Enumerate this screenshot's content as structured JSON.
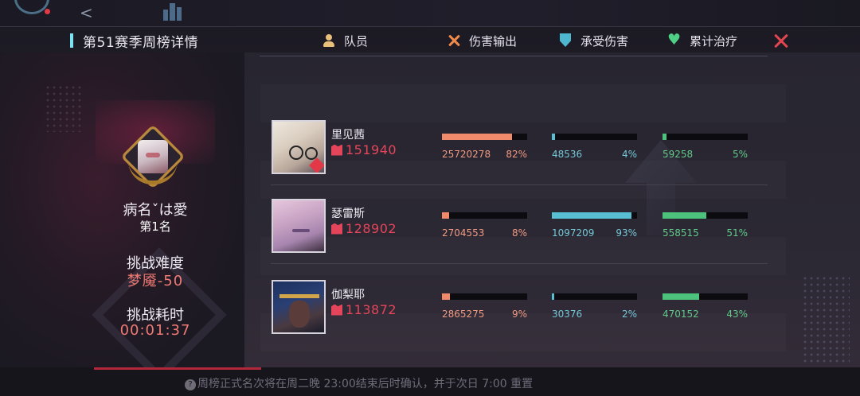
{
  "modal": {
    "title": "第51赛季周榜详情"
  },
  "player": {
    "name": "病名ˇは愛",
    "rank": "第1名",
    "difficulty_label": "挑战难度",
    "difficulty_value": "梦魇-50",
    "time_label": "挑战耗时",
    "time_value": "00:01:37"
  },
  "columns": {
    "member": "队员",
    "damage": "伤害输出",
    "taken": "承受伤害",
    "heal": "累计治疗"
  },
  "members": [
    {
      "name": "里见茜",
      "power": "151940",
      "damage": "25720278",
      "damage_pct": "82%",
      "damage_frac": 0.82,
      "taken": "48536",
      "taken_pct": "4%",
      "taken_frac": 0.04,
      "heal": "59258",
      "heal_pct": "5%",
      "heal_frac": 0.05
    },
    {
      "name": "瑟雷斯",
      "power": "128902",
      "damage": "2704553",
      "damage_pct": "8%",
      "damage_frac": 0.08,
      "taken": "1097209",
      "taken_pct": "93%",
      "taken_frac": 0.93,
      "heal": "558515",
      "heal_pct": "51%",
      "heal_frac": 0.51
    },
    {
      "name": "伽梨耶",
      "power": "113872",
      "damage": "2865275",
      "damage_pct": "9%",
      "damage_frac": 0.09,
      "taken": "30376",
      "taken_pct": "2%",
      "taken_frac": 0.02,
      "heal": "470152",
      "heal_pct": "43%",
      "heal_frac": 0.43
    }
  ],
  "footer": {
    "notice": "周榜正式名次将在周二晚 23:00结束后时确认，并于次日 7:00 重置"
  },
  "colors": {
    "damage": "#f08a6a",
    "taken": "#58c0d2",
    "heal": "#4cc27c",
    "accent_red": "#e5455a"
  },
  "icons": {
    "close": "close-icon",
    "member": "person-icon",
    "damage": "crossed-swords-icon",
    "taken": "shield-icon",
    "heal": "heart-icon"
  }
}
